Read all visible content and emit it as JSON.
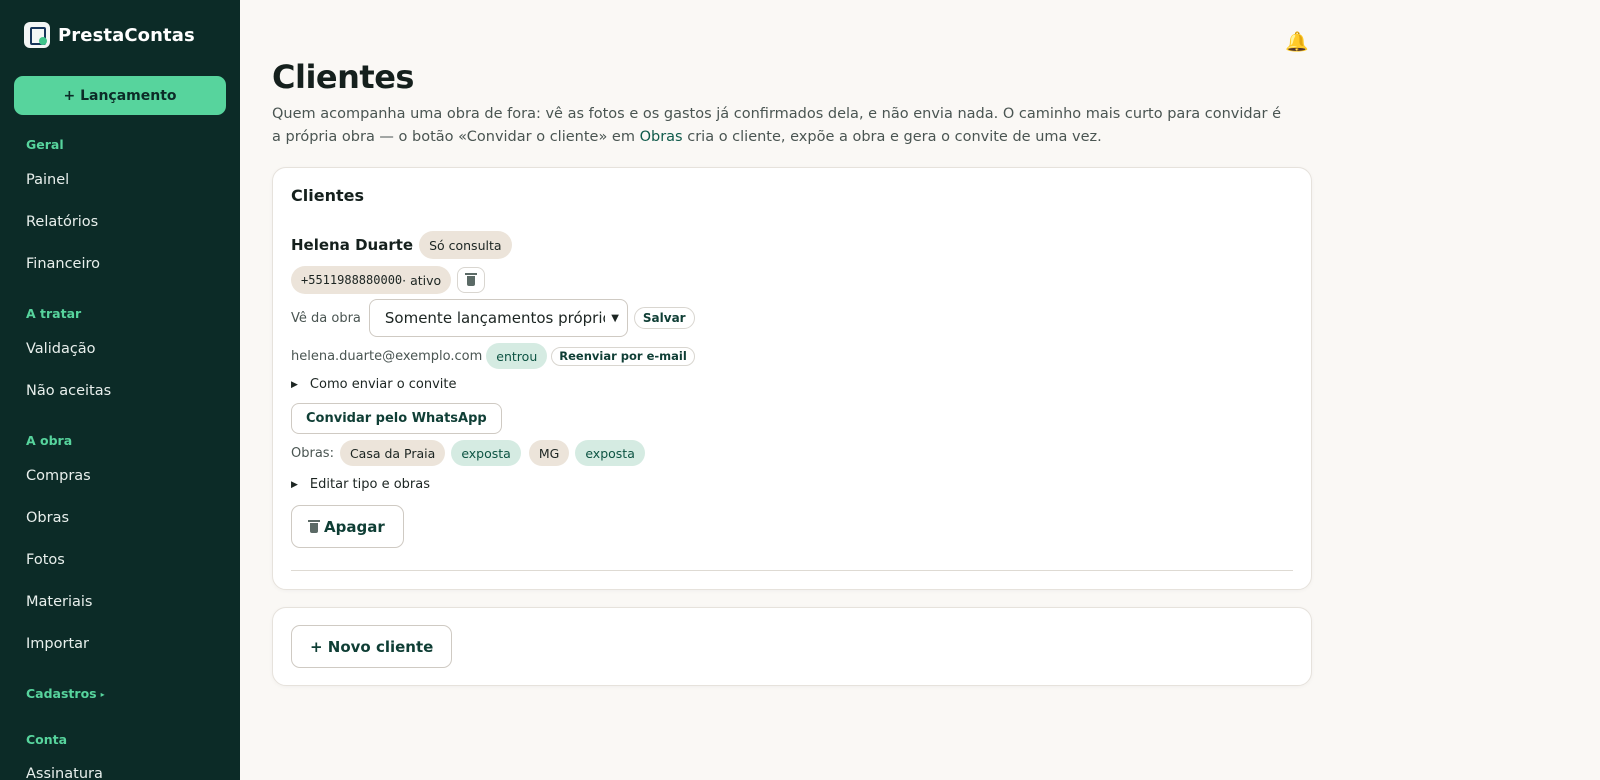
{
  "sidebar": {
    "brand": "PrestaContas",
    "cta_label": "+ Lançamento",
    "sections": [
      {
        "title": "Geral",
        "items": [
          "Painel",
          "Relatórios",
          "Financeiro"
        ]
      },
      {
        "title": "A tratar",
        "items": [
          "Validação",
          "Não aceitas"
        ]
      },
      {
        "title": "A obra",
        "items": [
          "Compras",
          "Obras",
          "Fotos",
          "Materiais",
          "Importar"
        ]
      },
      {
        "title": "Cadastros",
        "items": []
      },
      {
        "title": "Conta",
        "items": [
          "Assinatura"
        ]
      }
    ],
    "cadastros_caret": "▸"
  },
  "header": {
    "bell_icon": "🔔",
    "title": "Clientes",
    "description_before": "Quem acompanha uma obra de fora: vê as fotos e os gastos já confirmados dela, e não envia nada. O caminho mais curto para convidar é a própria obra — o botão «Convidar o cliente» em ",
    "description_link": "Obras",
    "description_after": " cria o cliente, expõe a obra e gera o convite de uma vez."
  },
  "clients_card": {
    "title": "Clientes",
    "client": {
      "name": "Helena Duarte",
      "type_badge": "Só consulta",
      "phone": "+5511988880000",
      "phone_status": " · ativo",
      "view_label": "Vê da obra",
      "view_select": "Somente lançamentos próprios",
      "save_label": "Salvar",
      "email": "helena.duarte@exemplo.com",
      "email_status": "entrou",
      "resend_label": "Reenviar por e-mail",
      "invite_details": "Como enviar o convite",
      "whatsapp_label": "Convidar pelo WhatsApp",
      "works_label": "Obras:",
      "works": [
        {
          "name": "Casa da Praia",
          "status": "exposta"
        },
        {
          "name": "MG",
          "status": "exposta"
        }
      ],
      "edit_details": "Editar tipo e obras",
      "delete_label": "Apagar"
    }
  },
  "new_client": {
    "label": "+ Novo cliente"
  }
}
